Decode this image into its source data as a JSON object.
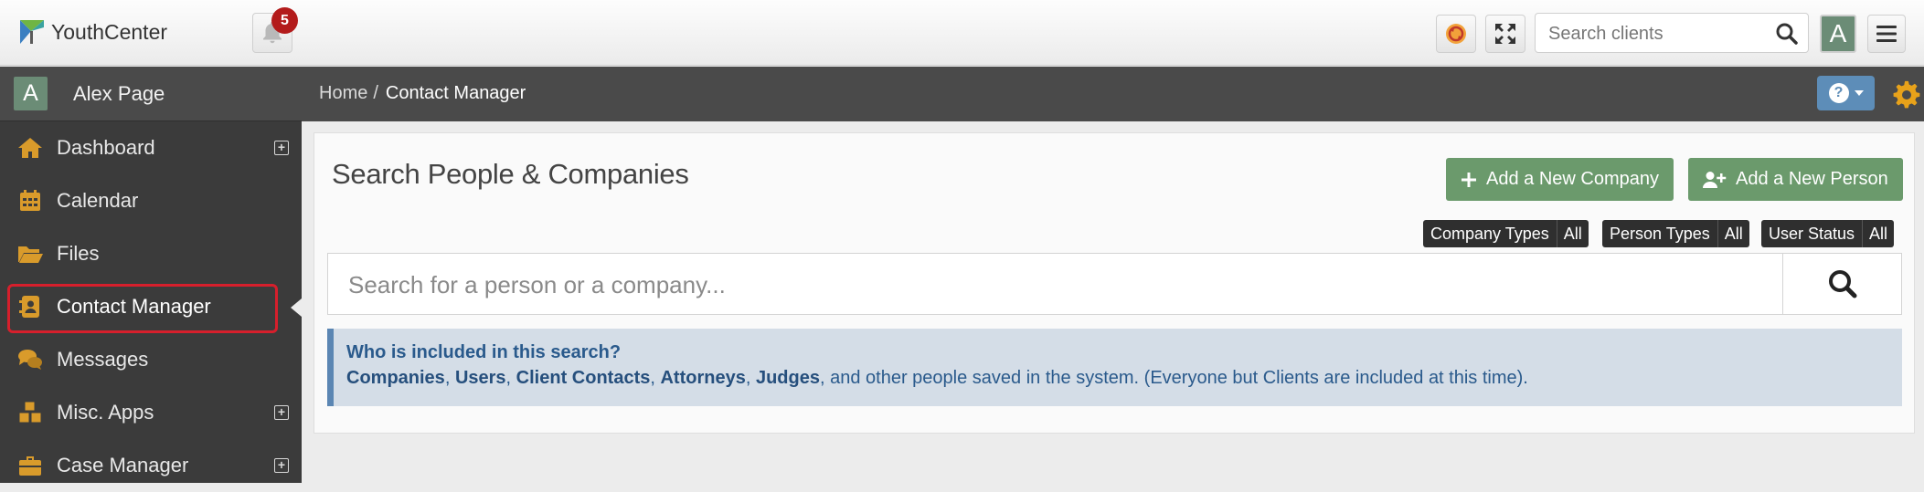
{
  "app": {
    "name": "YouthCenter"
  },
  "topbar": {
    "notification_count": "5",
    "search_placeholder": "Search clients",
    "user_initial": "A"
  },
  "sidebar": {
    "user": {
      "initial": "A",
      "name": "Alex Page"
    },
    "items": [
      {
        "label": "Dashboard",
        "icon": "home-icon",
        "expandable": true
      },
      {
        "label": "Calendar",
        "icon": "calendar-icon",
        "expandable": false
      },
      {
        "label": "Files",
        "icon": "folder-open-icon",
        "expandable": false
      },
      {
        "label": "Contact Manager",
        "icon": "address-book-icon",
        "expandable": false,
        "active": true
      },
      {
        "label": "Messages",
        "icon": "comments-icon",
        "expandable": false
      },
      {
        "label": "Misc. Apps",
        "icon": "cubes-icon",
        "expandable": true
      },
      {
        "label": "Case Manager",
        "icon": "briefcase-icon",
        "expandable": true
      }
    ]
  },
  "breadcrumb": {
    "home": "Home",
    "separator": "/",
    "current": "Contact Manager"
  },
  "main": {
    "title": "Search People & Companies",
    "add_company_label": "Add a New Company",
    "add_person_label": "Add a New Person",
    "filters": [
      {
        "label": "Company Types",
        "value": "All"
      },
      {
        "label": "Person Types",
        "value": "All"
      },
      {
        "label": "User Status",
        "value": "All"
      }
    ],
    "search_placeholder": "Search for a person or a company...",
    "info": {
      "heading": "Who is included in this search?",
      "links": [
        "Companies",
        "Users",
        "Client Contacts",
        "Attorneys",
        "Judges"
      ],
      "tail": ", and other people saved in the system. (Everyone but Clients are included at this time)."
    }
  },
  "colors": {
    "accent_green": "#6b9a6c",
    "avatar_green": "#6b8c76",
    "badge_red": "#b31b1b",
    "active_outline": "#d61f2c",
    "info_blue": "#2a5a8c",
    "help_blue": "#5d8db8",
    "cog_orange": "#e8a21a"
  }
}
